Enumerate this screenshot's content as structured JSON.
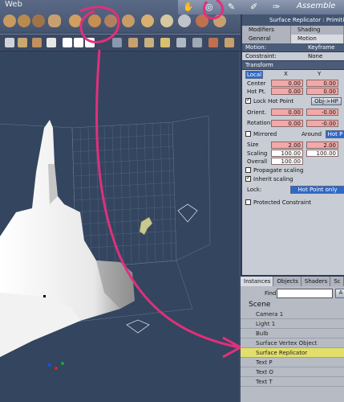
{
  "menubar": {
    "web": "Web"
  },
  "mode": {
    "assemble": "Assemble"
  },
  "panel": {
    "title": "Surface Replicator : Primitive",
    "tabs1": [
      "Modifiers",
      "Shading"
    ],
    "tabs2": [
      "General",
      "Motion"
    ],
    "motion_label": "Motion:",
    "motion_value": "Keyframe",
    "constraint_label": "Constraint:",
    "constraint_value": "None",
    "transform_label": "Transform",
    "local": "Local",
    "x": "X",
    "y": "Y",
    "center_label": "Center",
    "center_x": "0.00",
    "center_y": "0.00",
    "hotpt_label": "Hot Pt.",
    "hotpt_x": "0.00",
    "hotpt_y": "0.00",
    "lock_hot_point": "Lock Hot Point",
    "obj_hp": "Obj->HP",
    "orient_label": "Orient.",
    "orient_x": "0.00",
    "orient_y": "-0.00",
    "rotation_label": "Rotation",
    "rotation_x": "0.00",
    "rotation_y": "-0.00",
    "mirrored": "Mirrored",
    "around": "Around",
    "hot_p": "Hot P",
    "size_label": "Size",
    "size_x": "2.00",
    "size_y": "2.00",
    "scaling_label": "Scaling",
    "scaling_x": "100.00",
    "scaling_y": "100.00",
    "overall_label": "Overall",
    "overall_x": "100.00",
    "propagate": "Propagate scaling",
    "inherit": "Inherit scaling",
    "lock_label": "Lock:",
    "lock_value": "Hot Point only",
    "protected": "Protected Constraint"
  },
  "scene": {
    "tabs": [
      "Instances",
      "Objects",
      "Shaders",
      "Sc"
    ],
    "find_label": "Find:",
    "find_value": "",
    "find_btn": "A",
    "title": "Scene",
    "items": [
      "Camera 1",
      "Light 1",
      "Bulb",
      "Surface Vertex Object",
      "Surface Replicator",
      "Text P",
      "Text O",
      "Text T"
    ],
    "selected_index": 4
  },
  "colors": {
    "annotation": "#e0307a",
    "selected_row": "#e2df6a",
    "panel_header": "#4b5c79"
  }
}
